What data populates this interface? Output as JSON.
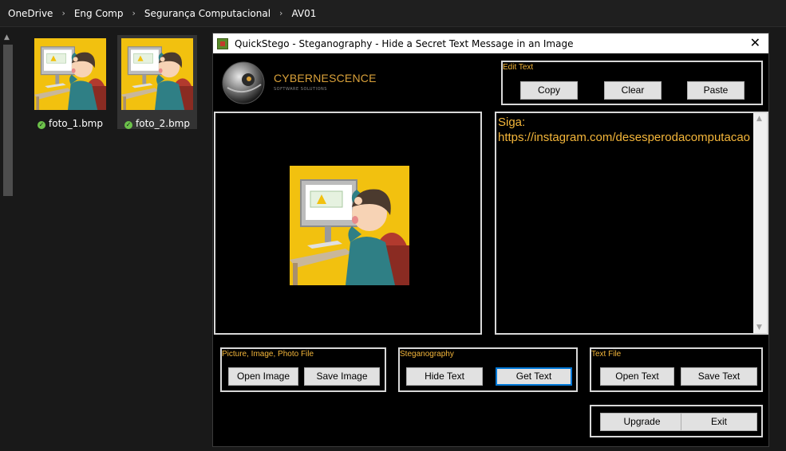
{
  "breadcrumb": {
    "items": [
      "OneDrive",
      "Eng Comp",
      "Segurança Computacional",
      "AV01"
    ],
    "separator": "›"
  },
  "files": [
    {
      "name": "foto_1.bmp",
      "status": "synced"
    },
    {
      "name": "foto_2.bmp",
      "status": "synced"
    }
  ],
  "window": {
    "title": "QuickStego - Steganography - Hide a Secret Text Message in an Image",
    "close_glyph": "✕"
  },
  "logo": {
    "name": "CYBERNESCENCE",
    "tagline": "SOFTWARE SOLUTIONS"
  },
  "edit_text": {
    "label": "Edit Text",
    "copy": "Copy",
    "clear": "Clear",
    "paste": "Paste"
  },
  "secret_text": "Siga:\nhttps://instagram.com/desesperodacomputacao",
  "picture_group": {
    "label": "Picture, Image, Photo File",
    "open": "Open Image",
    "save": "Save Image"
  },
  "stego_group": {
    "label": "Steganography",
    "hide": "Hide Text",
    "get": "Get Text"
  },
  "textfile_group": {
    "label": "Text File",
    "open": "Open Text",
    "save": "Save Text"
  },
  "bottom": {
    "upgrade": "Upgrade",
    "exit": "Exit"
  },
  "colors": {
    "accent_text": "#f4b63a",
    "logo_text": "#d9a13a",
    "focus_border": "#0078d7",
    "sync_ok": "#6cc24a"
  }
}
